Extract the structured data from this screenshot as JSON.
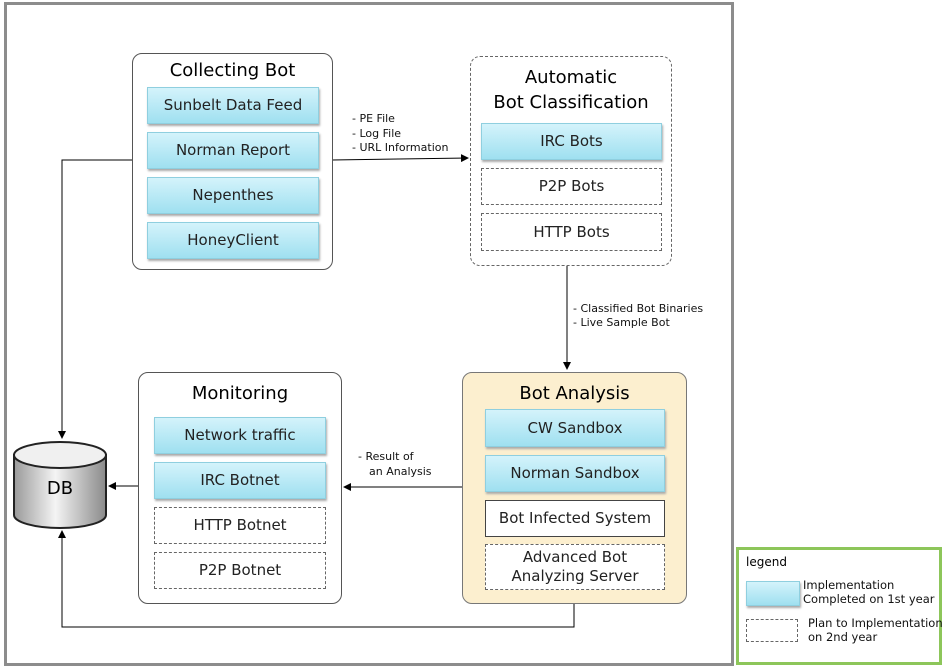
{
  "collecting": {
    "title": "Collecting Bot",
    "items": [
      "Sunbelt Data Feed",
      "Norman Report",
      "Nepenthes",
      "HoneyClient"
    ]
  },
  "classification": {
    "title_line1": "Automatic",
    "title_line2": "Bot Classification",
    "items": [
      "IRC Bots",
      "P2P Bots",
      "HTTP Bots"
    ]
  },
  "analysis": {
    "title": "Bot Analysis",
    "items": [
      "CW Sandbox",
      "Norman Sandbox",
      "Bot Infected System",
      "Advanced Bot Analyzing Server"
    ]
  },
  "monitoring": {
    "title": "Monitoring",
    "items": [
      "Network traffic",
      "IRC Botnet",
      "HTTP Botnet",
      "P2P Botnet"
    ]
  },
  "db": {
    "label": "DB"
  },
  "edges": {
    "collect_to_class": [
      "- PE File",
      "- Log File",
      "- URL Information"
    ],
    "class_to_analysis": [
      "- Classified Bot Binaries",
      "- Live Sample Bot"
    ],
    "analysis_to_monitoring": [
      "- Result of",
      "an Analysis"
    ]
  },
  "legend": {
    "title": "legend",
    "implemented": "Implementation\nCompleted on 1st year",
    "planned": "Plan to Implementation\non 2nd year"
  },
  "colors": {
    "implemented": "#a8e3f2",
    "analysis_bg": "#fcefcf",
    "legend_border": "#8dc65a"
  }
}
